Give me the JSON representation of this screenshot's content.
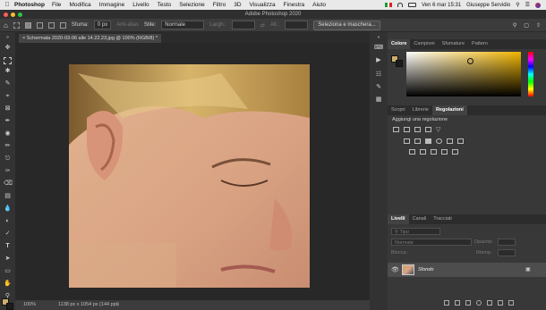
{
  "menubar": {
    "app": "Photoshop",
    "items": [
      "File",
      "Modifica",
      "Immagine",
      "Livello",
      "Testo",
      "Selezione",
      "Filtro",
      "3D",
      "Visualizza",
      "Finestra",
      "Aiuto"
    ],
    "datetime": "Ven 6 mar  15:31",
    "user": "Giuseppe Servidio"
  },
  "window": {
    "title": "Adobe Photoshop 2020"
  },
  "options": {
    "feather_label": "Sfuma:",
    "feather_value": "0 px",
    "antialias_label": "Anti-alias",
    "style_label": "Stile:",
    "style_value": "Normale",
    "width_label": "Largh.:",
    "height_label": "Alt.:",
    "select_mask_label": "Seleziona e maschera..."
  },
  "document": {
    "tab_label": "Schermata 2020-03-06 alle 14.22.23.jpg @ 100% (RGB/8) *",
    "zoom": "100%",
    "status": "1138 px x 1054 px (144 ppi)"
  },
  "color_panel": {
    "tabs": [
      "Colore",
      "Campioni",
      "Sfumature",
      "Pattern"
    ],
    "active_tab": "Colore",
    "foreground": "#cfae6e",
    "background": "#1c1c1c"
  },
  "adjustments_panel": {
    "tabs": [
      "Scopri",
      "Librerie",
      "Regolazioni"
    ],
    "active_tab": "Regolazioni",
    "heading": "Aggiungi una regolazione"
  },
  "layers_panel": {
    "tabs": [
      "Livelli",
      "Canali",
      "Tracciati"
    ],
    "active_tab": "Livelli",
    "search_placeholder": "Tipo",
    "blend_mode": "Normale",
    "opacity_label": "Opacità:",
    "lock_label": "Blocca:",
    "fill_label": "Riemp.:",
    "layers": [
      {
        "name": "Sfondo"
      }
    ]
  }
}
